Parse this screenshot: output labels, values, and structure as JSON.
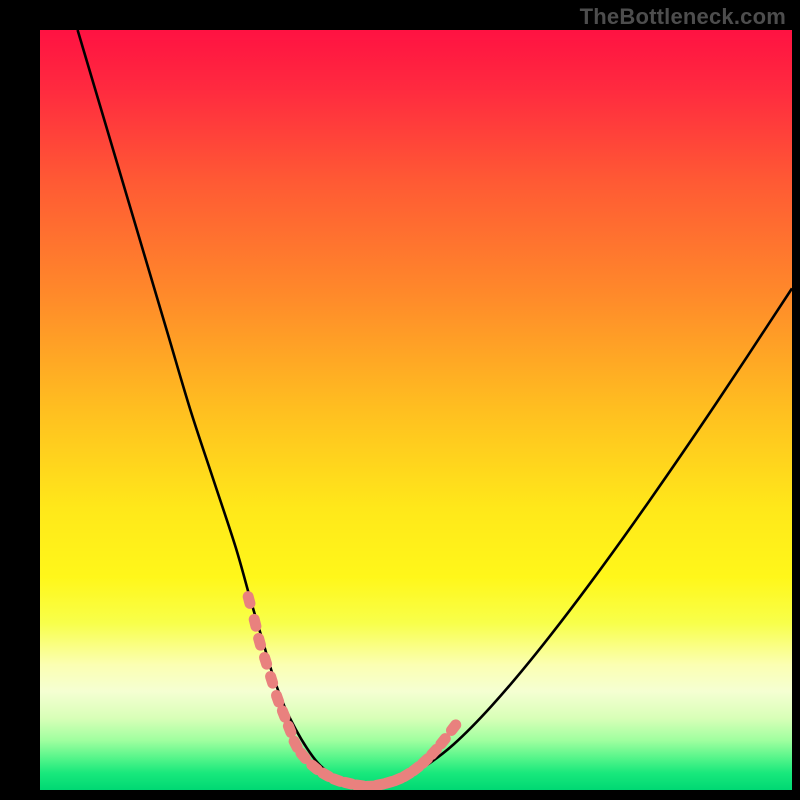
{
  "watermark": "TheBottleneck.com",
  "colors": {
    "black": "#000000",
    "curve": "#000000",
    "marker_fill": "#e9817e",
    "marker_stroke": "#e9817e",
    "gradient_stops": [
      {
        "offset": 0.0,
        "color": "#ff1242"
      },
      {
        "offset": 0.08,
        "color": "#ff2b3f"
      },
      {
        "offset": 0.2,
        "color": "#ff5a34"
      },
      {
        "offset": 0.35,
        "color": "#ff8a2a"
      },
      {
        "offset": 0.5,
        "color": "#ffbf20"
      },
      {
        "offset": 0.63,
        "color": "#ffe81a"
      },
      {
        "offset": 0.72,
        "color": "#fff71a"
      },
      {
        "offset": 0.78,
        "color": "#f8ff4a"
      },
      {
        "offset": 0.835,
        "color": "#fbffb2"
      },
      {
        "offset": 0.87,
        "color": "#f5ffd2"
      },
      {
        "offset": 0.905,
        "color": "#d9ffb8"
      },
      {
        "offset": 0.935,
        "color": "#9fff9f"
      },
      {
        "offset": 0.958,
        "color": "#55f58a"
      },
      {
        "offset": 0.978,
        "color": "#18e87c"
      },
      {
        "offset": 1.0,
        "color": "#00d873"
      }
    ]
  },
  "chart_data": {
    "type": "line",
    "title": "",
    "xlabel": "",
    "ylabel": "",
    "xlim": [
      0,
      100
    ],
    "ylim": [
      0,
      100
    ],
    "grid": false,
    "legend": false,
    "series": [
      {
        "name": "bottleneck-curve",
        "x": [
          5,
          8,
          11,
          14,
          17,
          20,
          23,
          26,
          28,
          29.5,
          31,
          32.5,
          34,
          35.5,
          37,
          38.5,
          40,
          42,
          44,
          46,
          48,
          51,
          55,
          60,
          66,
          73,
          81,
          90,
          100
        ],
        "y": [
          100,
          90,
          80,
          70,
          60,
          50,
          41,
          32,
          25,
          20,
          15,
          11,
          8,
          5.5,
          3.5,
          2.2,
          1.3,
          0.8,
          0.5,
          0.8,
          1.5,
          3,
          6,
          11,
          18,
          27,
          38,
          51,
          66
        ]
      }
    ],
    "markers": {
      "name": "highlight-points",
      "comment": "Pink capsule markers overlaying the curve near its minimum",
      "x": [
        27.8,
        28.6,
        29.2,
        30.0,
        30.8,
        31.6,
        32.4,
        33.2,
        34.0,
        35.0,
        36.5,
        38.0,
        39.5,
        41.0,
        42.5,
        44.0,
        45.2,
        46.4,
        47.6,
        48.8,
        50.0,
        51.2,
        52.4,
        53.6,
        55.0
      ],
      "y": [
        25.0,
        22.0,
        19.5,
        17.0,
        14.5,
        12.0,
        10.0,
        8.0,
        6.0,
        4.5,
        3.0,
        2.0,
        1.3,
        0.9,
        0.6,
        0.5,
        0.7,
        1.0,
        1.4,
        2.0,
        2.8,
        3.8,
        5.0,
        6.4,
        8.2
      ]
    }
  }
}
